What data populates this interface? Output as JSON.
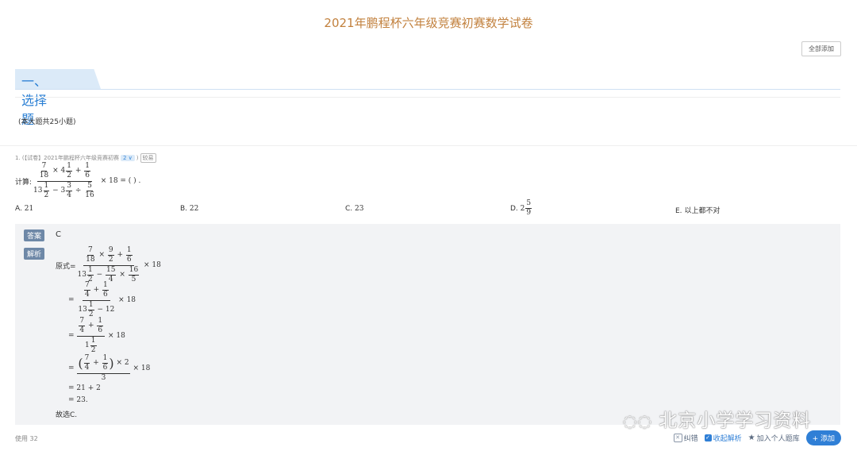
{
  "header": {
    "title": "2021年鹏程杯六年级竞赛初赛数学试卷",
    "add_all": "全部添加"
  },
  "section": {
    "title": "一、选择题",
    "count_note": "(本大题共25小题)"
  },
  "question": {
    "meta_prefix": "1. (【试卷】2021年鹏程杯六年级竞赛初赛",
    "meta_select": "2 ∨",
    "meta_suffix": ")",
    "meta_tag": "较易",
    "prompt_prefix": "计算:",
    "prompt_suffix": "× 18 = (  ) .",
    "options": [
      {
        "letter": "A.",
        "text": "21"
      },
      {
        "letter": "B.",
        "text": "22"
      },
      {
        "letter": "C.",
        "text": "23"
      },
      {
        "letter": "D.",
        "text": "2"
      },
      {
        "letter": "E.",
        "text": "以上都不对"
      }
    ]
  },
  "answer": {
    "answer_label": "答案",
    "answer_value": "C",
    "analysis_label": "解析",
    "analysis_start": "原式=",
    "line5": "= 21 + 2",
    "line6": "= 23.",
    "conclusion": "故选C."
  },
  "footer": {
    "usage": "使用 32",
    "report": "纠错",
    "collapse": "收起解析",
    "add_bank": "加入个人题库",
    "add": "+ 添加"
  },
  "watermark": "北京小学学习资料"
}
